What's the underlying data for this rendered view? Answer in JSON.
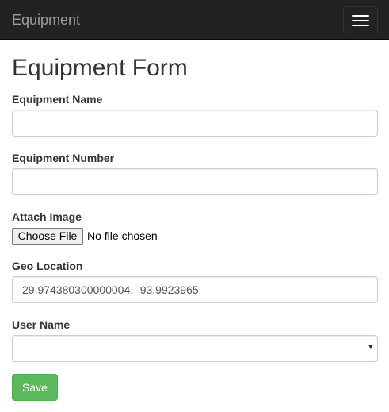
{
  "navbar": {
    "brand": "Equipment",
    "toggle_icon": "hamburger-menu-icon"
  },
  "page": {
    "title": "Equipment Form"
  },
  "form": {
    "equipment_name": {
      "label": "Equipment Name",
      "value": ""
    },
    "equipment_number": {
      "label": "Equipment Number",
      "value": ""
    },
    "attach_image": {
      "label": "Attach Image",
      "button_label": "Choose File",
      "status": "No file chosen"
    },
    "geo_location": {
      "label": "Geo Location",
      "value": "29.974380300000004, -93.9923965"
    },
    "user_name": {
      "label": "User Name",
      "selected": "",
      "arrow_icon": "dropdown-arrow-icon"
    },
    "save_label": "Save"
  },
  "colors": {
    "navbar_bg": "#222222",
    "brand_text": "#9d9d9d",
    "save_button": "#5cb85c"
  }
}
